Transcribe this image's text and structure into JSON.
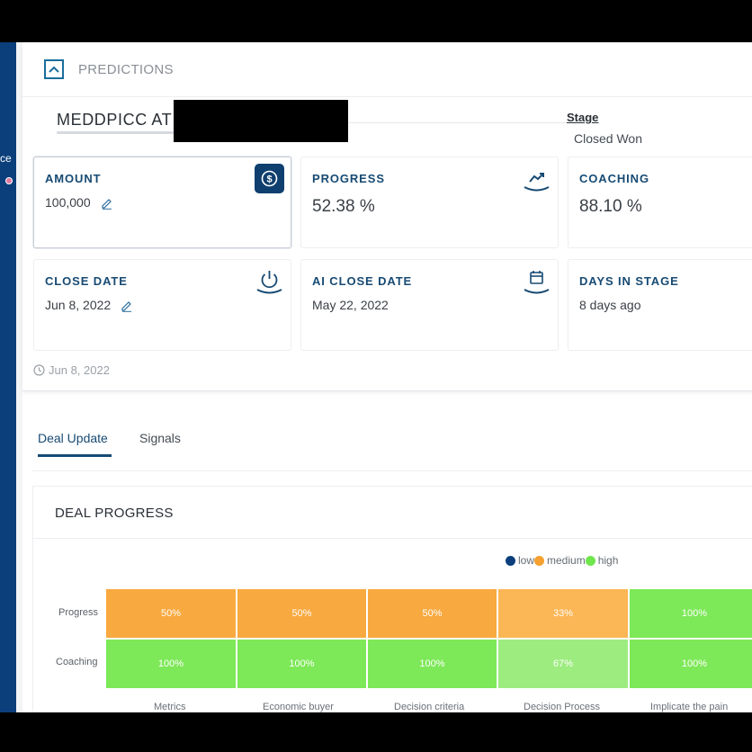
{
  "sidebar": {
    "text": "ce"
  },
  "header": {
    "title": "PREDICTIONS"
  },
  "deal": {
    "title": "MEDDPICC AT"
  },
  "stage": {
    "label": "Stage",
    "value": "Closed Won"
  },
  "cards": {
    "amount": {
      "label": "AMOUNT",
      "value": "100,000"
    },
    "progress": {
      "label": "PROGRESS",
      "value": "52.38 %"
    },
    "coaching": {
      "label": "COACHING",
      "value": "88.10 %"
    },
    "close_date": {
      "label": "CLOSE DATE",
      "value": "Jun 8, 2022"
    },
    "ai_close_date": {
      "label": "AI CLOSE DATE",
      "value": "May 22, 2022"
    },
    "days_in_stage": {
      "label": "DAYS IN STAGE",
      "value": "8 days ago"
    }
  },
  "timestamp": "Jun 8, 2022",
  "tabs": [
    {
      "label": "Deal Update",
      "active": true
    },
    {
      "label": "Signals",
      "active": false
    }
  ],
  "deal_progress": {
    "title": "DEAL PROGRESS",
    "legend": [
      {
        "label": "low",
        "color": "#0b3f7c"
      },
      {
        "label": "medium",
        "color": "#f6a02f"
      },
      {
        "label": "high",
        "color": "#6fe64b"
      }
    ],
    "rows": [
      {
        "label": "Progress",
        "cells": [
          {
            "text": "50%",
            "level": "medium",
            "color": "#f8a93f"
          },
          {
            "text": "50%",
            "level": "medium",
            "color": "#f8a93f"
          },
          {
            "text": "50%",
            "level": "medium",
            "color": "#f8a93f"
          },
          {
            "text": "33%",
            "level": "medium",
            "color": "#fbb655"
          },
          {
            "text": "100%",
            "level": "high",
            "color": "#7de858"
          }
        ]
      },
      {
        "label": "Coaching",
        "cells": [
          {
            "text": "100%",
            "level": "high",
            "color": "#7de858"
          },
          {
            "text": "100%",
            "level": "high",
            "color": "#7de858"
          },
          {
            "text": "100%",
            "level": "high",
            "color": "#7de858"
          },
          {
            "text": "67%",
            "level": "high",
            "color": "#9dec80"
          },
          {
            "text": "100%",
            "level": "high",
            "color": "#7de858"
          }
        ]
      }
    ],
    "columns": [
      "Metrics",
      "Economic buyer",
      "Decision criteria",
      "Decision Process",
      "Implicate the pain"
    ]
  }
}
